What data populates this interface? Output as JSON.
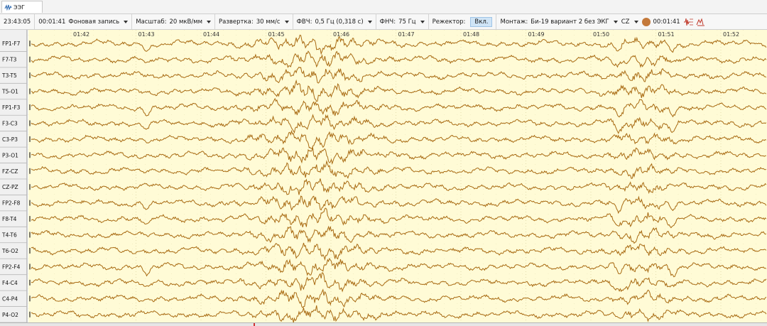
{
  "tab": {
    "label": "ЭЭГ",
    "icon": "eeg-wave-icon"
  },
  "toolbar": {
    "clock": "23:43:05",
    "elapsed": "00:01:41",
    "record_type": "Фоновая запись",
    "scale_label": "Масштаб:",
    "scale_value": "20 мкВ/мм",
    "sweep_label": "Развертка:",
    "sweep_value": "30 мм/с",
    "hpf_label": "ФВЧ:",
    "hpf_value": "0,5 Гц (0,318 с)",
    "lpf_label": "ФНЧ:",
    "lpf_value": "75 Гц",
    "notch_label": "Режектор:",
    "notch_value": "Вкл.",
    "montage_label": "Монтаж:",
    "montage_value": "Би-19 вариант 2 без ЭКГ",
    "reference_value": "CZ",
    "cursor_time": "00:01:41"
  },
  "colors": {
    "trace": "#a86a12",
    "background": "#fffbd6",
    "grid": "#d9cf9a",
    "label_bg": "#f0f0f0"
  },
  "time_labels": [
    "01:42",
    "01:43",
    "01:44",
    "01:45",
    "01:46",
    "01:47",
    "01:48",
    "01:49",
    "01:50",
    "01:51",
    "01:52"
  ],
  "channels": [
    "FP1-F7",
    "F7-T3",
    "T3-T5",
    "T5-O1",
    "FP1-F3",
    "F3-C3",
    "C3-P3",
    "P3-O1",
    "FZ-CZ",
    "CZ-PZ",
    "FP2-F8",
    "F8-T4",
    "T4-T6",
    "T6-O2",
    "FP2-F4",
    "F4-C4",
    "C4-P4",
    "P4-O2"
  ]
}
